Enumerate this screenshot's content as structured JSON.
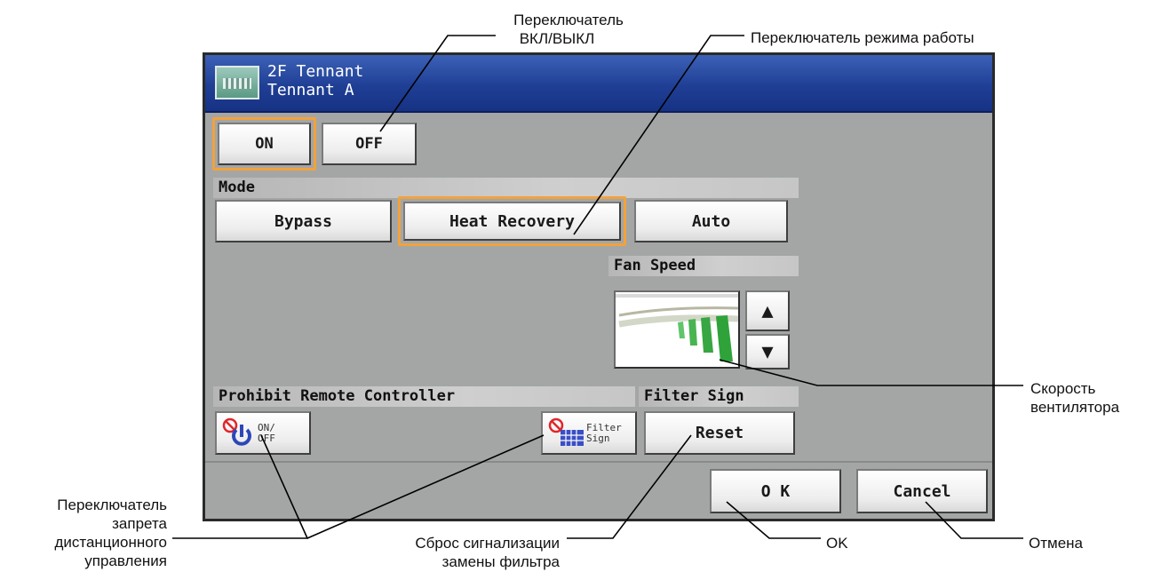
{
  "window": {
    "title_line1": "2F Tennant",
    "title_line2": "Tennant A"
  },
  "power": {
    "on_label": "ON",
    "off_label": "OFF",
    "selected": "ON"
  },
  "mode": {
    "section_label": "Mode",
    "options": [
      "Bypass",
      "Heat Recovery",
      "Auto"
    ],
    "selected": "Heat Recovery"
  },
  "fan_speed": {
    "section_label": "Fan Speed",
    "up_glyph": "▲",
    "down_glyph": "▼"
  },
  "prohibit": {
    "section_label": "Prohibit Remote Controller",
    "onoff_label_line1": "ON/",
    "onoff_label_line2": "OFF",
    "filter_label_line1": "Filter",
    "filter_label_line2": "Sign"
  },
  "filter_sign": {
    "section_label": "Filter Sign",
    "reset_label": "Reset"
  },
  "footer": {
    "ok_label": "O K",
    "cancel_label": "Cancel"
  },
  "annotations": {
    "onoff_line1": "Переключатель",
    "onoff_line2": "ВКЛ/ВЫКЛ",
    "mode": "Переключатель режима работы",
    "fan_line1": "Скорость",
    "fan_line2": "вентилятора",
    "prohibit_line1": "Переключатель",
    "prohibit_line2": "запрета",
    "prohibit_line3": "дистанционного",
    "prohibit_line4": "управления",
    "filter_reset_line1": "Сброс сигнализации",
    "filter_reset_line2": "замены фильтра",
    "ok": "OK",
    "cancel": "Отмена"
  },
  "colors": {
    "title_bar": "#1f3f95",
    "panel_bg": "#a4a6a6",
    "selection_frame": "#f2a23c",
    "fan_speed_green": "#2fa33a"
  }
}
